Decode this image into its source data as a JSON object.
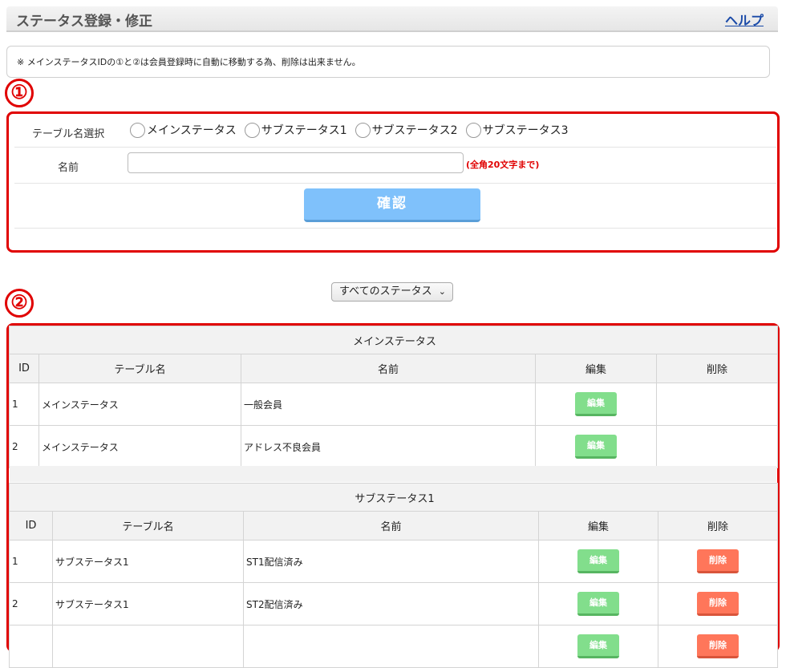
{
  "header": {
    "title": "ステータス登録・修正",
    "help_label": "ヘルプ"
  },
  "notice": "※ メインステータスIDの①と②は会員登録時に自動に移動する為、削除は出来ません。",
  "markers": {
    "one": "①",
    "two": "②"
  },
  "form": {
    "table_select_label": "テーブル名選択",
    "radio_options": [
      "メインステータス",
      "サブステータス1",
      "サブステータス2",
      "サブステータス3"
    ],
    "name_label": "名前",
    "name_value": "",
    "name_limit": "(全角20文字まで)",
    "confirm_label": "確認"
  },
  "filter": {
    "selected": "すべてのステータス"
  },
  "columns": {
    "id": "ID",
    "table": "テーブル名",
    "name": "名前",
    "edit": "編集",
    "delete": "削除"
  },
  "buttons": {
    "edit": "編集",
    "delete": "削除"
  },
  "main_table": {
    "caption": "メインステータス",
    "rows": [
      {
        "id": "1",
        "table": "メインステータス",
        "name": "一般会員"
      },
      {
        "id": "2",
        "table": "メインステータス",
        "name": "アドレス不良会員"
      }
    ]
  },
  "sub_table": {
    "caption": "サブステータス1",
    "rows": [
      {
        "id": "1",
        "table": "サブステータス1",
        "name": "ST1配信済み"
      },
      {
        "id": "2",
        "table": "サブステータス1",
        "name": "ST2配信済み"
      },
      {
        "id": "",
        "table": "",
        "name": ""
      }
    ]
  },
  "colors": {
    "accent_red": "#e00000",
    "confirm_blue": "#7fc1fb",
    "edit_green": "#82de8c",
    "delete_red": "#ff765a"
  }
}
